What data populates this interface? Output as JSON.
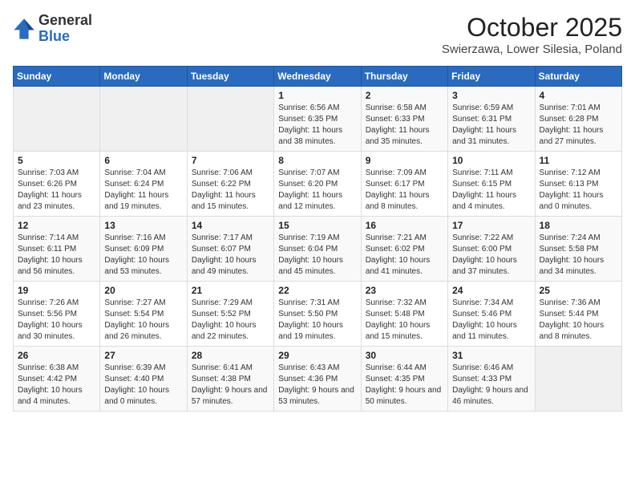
{
  "header": {
    "logo_general": "General",
    "logo_blue": "Blue",
    "month": "October 2025",
    "location": "Swierzawa, Lower Silesia, Poland"
  },
  "weekdays": [
    "Sunday",
    "Monday",
    "Tuesday",
    "Wednesday",
    "Thursday",
    "Friday",
    "Saturday"
  ],
  "weeks": [
    [
      {
        "day": "",
        "sunrise": "",
        "sunset": "",
        "daylight": ""
      },
      {
        "day": "",
        "sunrise": "",
        "sunset": "",
        "daylight": ""
      },
      {
        "day": "",
        "sunrise": "",
        "sunset": "",
        "daylight": ""
      },
      {
        "day": "1",
        "sunrise": "Sunrise: 6:56 AM",
        "sunset": "Sunset: 6:35 PM",
        "daylight": "Daylight: 11 hours and 38 minutes."
      },
      {
        "day": "2",
        "sunrise": "Sunrise: 6:58 AM",
        "sunset": "Sunset: 6:33 PM",
        "daylight": "Daylight: 11 hours and 35 minutes."
      },
      {
        "day": "3",
        "sunrise": "Sunrise: 6:59 AM",
        "sunset": "Sunset: 6:31 PM",
        "daylight": "Daylight: 11 hours and 31 minutes."
      },
      {
        "day": "4",
        "sunrise": "Sunrise: 7:01 AM",
        "sunset": "Sunset: 6:28 PM",
        "daylight": "Daylight: 11 hours and 27 minutes."
      }
    ],
    [
      {
        "day": "5",
        "sunrise": "Sunrise: 7:03 AM",
        "sunset": "Sunset: 6:26 PM",
        "daylight": "Daylight: 11 hours and 23 minutes."
      },
      {
        "day": "6",
        "sunrise": "Sunrise: 7:04 AM",
        "sunset": "Sunset: 6:24 PM",
        "daylight": "Daylight: 11 hours and 19 minutes."
      },
      {
        "day": "7",
        "sunrise": "Sunrise: 7:06 AM",
        "sunset": "Sunset: 6:22 PM",
        "daylight": "Daylight: 11 hours and 15 minutes."
      },
      {
        "day": "8",
        "sunrise": "Sunrise: 7:07 AM",
        "sunset": "Sunset: 6:20 PM",
        "daylight": "Daylight: 11 hours and 12 minutes."
      },
      {
        "day": "9",
        "sunrise": "Sunrise: 7:09 AM",
        "sunset": "Sunset: 6:17 PM",
        "daylight": "Daylight: 11 hours and 8 minutes."
      },
      {
        "day": "10",
        "sunrise": "Sunrise: 7:11 AM",
        "sunset": "Sunset: 6:15 PM",
        "daylight": "Daylight: 11 hours and 4 minutes."
      },
      {
        "day": "11",
        "sunrise": "Sunrise: 7:12 AM",
        "sunset": "Sunset: 6:13 PM",
        "daylight": "Daylight: 11 hours and 0 minutes."
      }
    ],
    [
      {
        "day": "12",
        "sunrise": "Sunrise: 7:14 AM",
        "sunset": "Sunset: 6:11 PM",
        "daylight": "Daylight: 10 hours and 56 minutes."
      },
      {
        "day": "13",
        "sunrise": "Sunrise: 7:16 AM",
        "sunset": "Sunset: 6:09 PM",
        "daylight": "Daylight: 10 hours and 53 minutes."
      },
      {
        "day": "14",
        "sunrise": "Sunrise: 7:17 AM",
        "sunset": "Sunset: 6:07 PM",
        "daylight": "Daylight: 10 hours and 49 minutes."
      },
      {
        "day": "15",
        "sunrise": "Sunrise: 7:19 AM",
        "sunset": "Sunset: 6:04 PM",
        "daylight": "Daylight: 10 hours and 45 minutes."
      },
      {
        "day": "16",
        "sunrise": "Sunrise: 7:21 AM",
        "sunset": "Sunset: 6:02 PM",
        "daylight": "Daylight: 10 hours and 41 minutes."
      },
      {
        "day": "17",
        "sunrise": "Sunrise: 7:22 AM",
        "sunset": "Sunset: 6:00 PM",
        "daylight": "Daylight: 10 hours and 37 minutes."
      },
      {
        "day": "18",
        "sunrise": "Sunrise: 7:24 AM",
        "sunset": "Sunset: 5:58 PM",
        "daylight": "Daylight: 10 hours and 34 minutes."
      }
    ],
    [
      {
        "day": "19",
        "sunrise": "Sunrise: 7:26 AM",
        "sunset": "Sunset: 5:56 PM",
        "daylight": "Daylight: 10 hours and 30 minutes."
      },
      {
        "day": "20",
        "sunrise": "Sunrise: 7:27 AM",
        "sunset": "Sunset: 5:54 PM",
        "daylight": "Daylight: 10 hours and 26 minutes."
      },
      {
        "day": "21",
        "sunrise": "Sunrise: 7:29 AM",
        "sunset": "Sunset: 5:52 PM",
        "daylight": "Daylight: 10 hours and 22 minutes."
      },
      {
        "day": "22",
        "sunrise": "Sunrise: 7:31 AM",
        "sunset": "Sunset: 5:50 PM",
        "daylight": "Daylight: 10 hours and 19 minutes."
      },
      {
        "day": "23",
        "sunrise": "Sunrise: 7:32 AM",
        "sunset": "Sunset: 5:48 PM",
        "daylight": "Daylight: 10 hours and 15 minutes."
      },
      {
        "day": "24",
        "sunrise": "Sunrise: 7:34 AM",
        "sunset": "Sunset: 5:46 PM",
        "daylight": "Daylight: 10 hours and 11 minutes."
      },
      {
        "day": "25",
        "sunrise": "Sunrise: 7:36 AM",
        "sunset": "Sunset: 5:44 PM",
        "daylight": "Daylight: 10 hours and 8 minutes."
      }
    ],
    [
      {
        "day": "26",
        "sunrise": "Sunrise: 6:38 AM",
        "sunset": "Sunset: 4:42 PM",
        "daylight": "Daylight: 10 hours and 4 minutes."
      },
      {
        "day": "27",
        "sunrise": "Sunrise: 6:39 AM",
        "sunset": "Sunset: 4:40 PM",
        "daylight": "Daylight: 10 hours and 0 minutes."
      },
      {
        "day": "28",
        "sunrise": "Sunrise: 6:41 AM",
        "sunset": "Sunset: 4:38 PM",
        "daylight": "Daylight: 9 hours and 57 minutes."
      },
      {
        "day": "29",
        "sunrise": "Sunrise: 6:43 AM",
        "sunset": "Sunset: 4:36 PM",
        "daylight": "Daylight: 9 hours and 53 minutes."
      },
      {
        "day": "30",
        "sunrise": "Sunrise: 6:44 AM",
        "sunset": "Sunset: 4:35 PM",
        "daylight": "Daylight: 9 hours and 50 minutes."
      },
      {
        "day": "31",
        "sunrise": "Sunrise: 6:46 AM",
        "sunset": "Sunset: 4:33 PM",
        "daylight": "Daylight: 9 hours and 46 minutes."
      },
      {
        "day": "",
        "sunrise": "",
        "sunset": "",
        "daylight": ""
      }
    ]
  ]
}
